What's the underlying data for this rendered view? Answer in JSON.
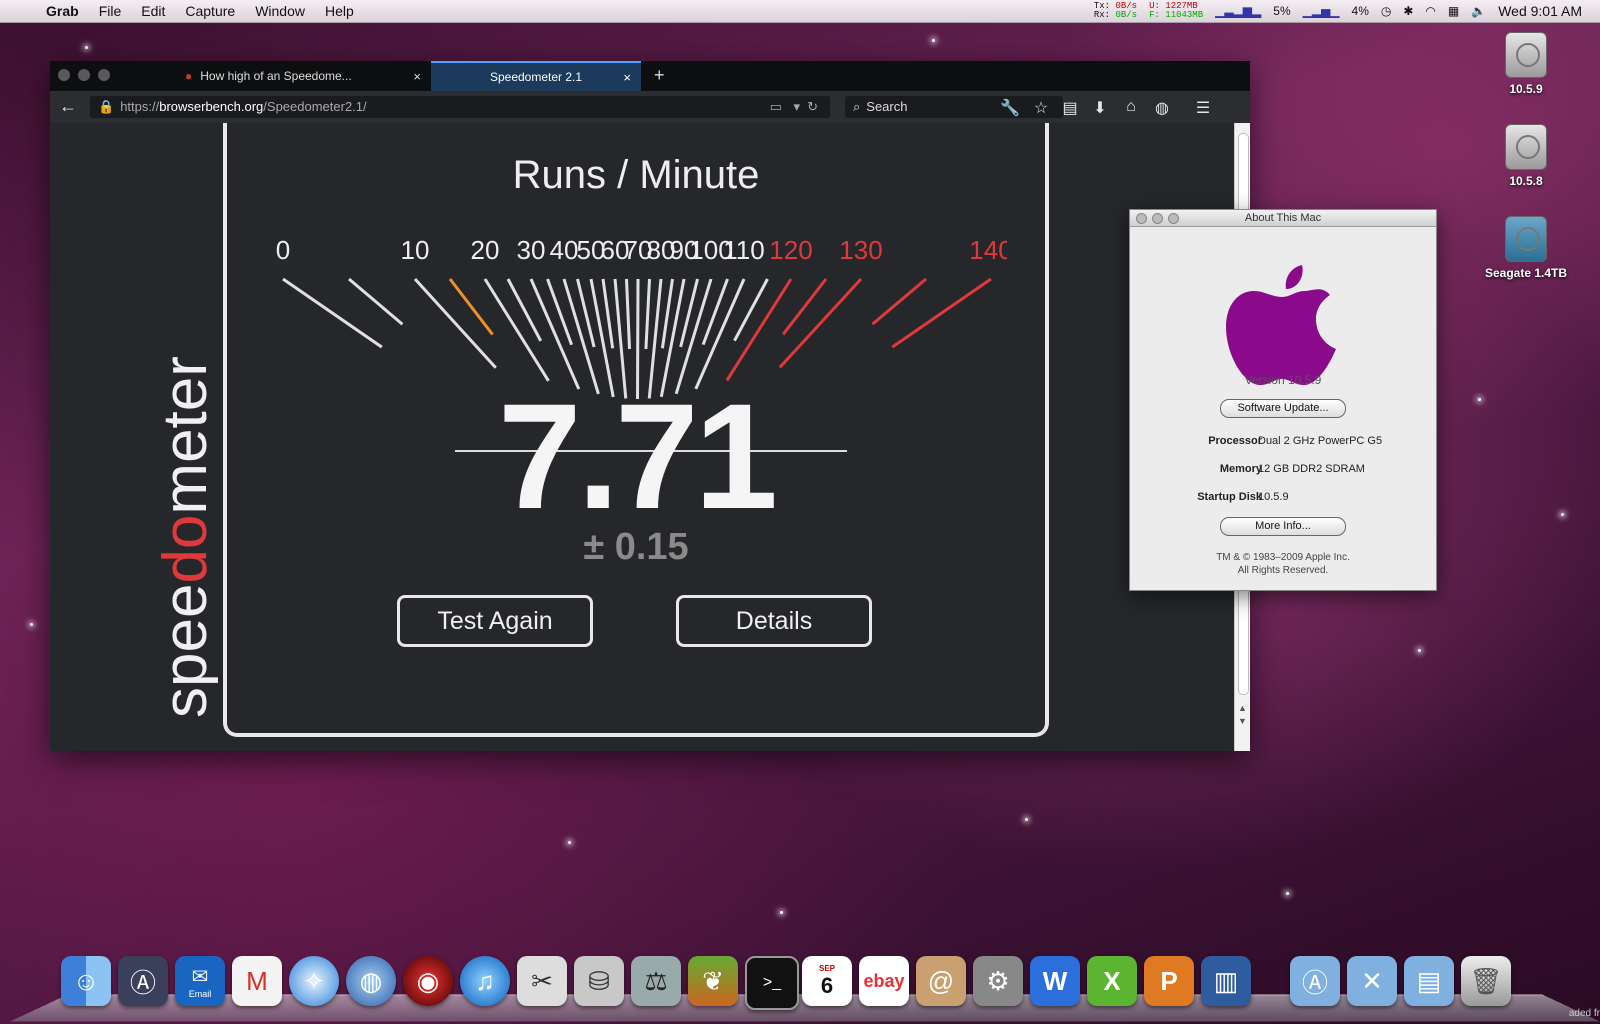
{
  "menubar": {
    "apple_glyph": "",
    "app_name": "Grab",
    "menus": [
      "File",
      "Edit",
      "Capture",
      "Window",
      "Help"
    ],
    "net_tx_label": "Tx:",
    "net_rx_label": "Rx:",
    "net_tx": "0B/s",
    "net_rx": "0B/s",
    "mem_u": "U: 1227MB",
    "mem_f": "F: 11043MB",
    "cpu1": "5%",
    "cpu2": "4%",
    "clock": "Wed 9:01 AM"
  },
  "browser": {
    "tabs": [
      {
        "label": "How high of an Speedome...",
        "close": "×"
      },
      {
        "label": "Speedometer 2.1",
        "close": "×"
      }
    ],
    "new_tab": "+",
    "url_prefix": "https://",
    "url_domain": "browserbench.org",
    "url_path": "/Speedometer2.1/",
    "search_placeholder": "Search"
  },
  "speedometer": {
    "logo_text": "speedometer",
    "title": "Runs / Minute",
    "gauge_labels": [
      "0",
      "10",
      "20",
      "30",
      "40",
      "50",
      "60",
      "70",
      "80",
      "90",
      "100",
      "110",
      "120",
      "130",
      "140"
    ],
    "score": "7.71",
    "margin": "± 0.15",
    "score_value": 7.71,
    "test_again": "Test Again",
    "details": "Details"
  },
  "about": {
    "title": "About This Mac",
    "version": "Version 10.5.9",
    "software_update": "Software Update...",
    "specs": [
      {
        "key": "Processor",
        "value": "Dual 2 GHz PowerPC G5"
      },
      {
        "key": "Memory",
        "value": "12 GB DDR2 SDRAM"
      },
      {
        "key": "Startup Disk",
        "value": "10.5.9"
      }
    ],
    "more_info": "More Info...",
    "copyright_1": "TM & © 1983–2009 Apple Inc.",
    "copyright_2": "All Rights Reserved."
  },
  "desktop": {
    "icons": [
      "10.5.9",
      "10.5.8",
      "Seagate 1.4TB"
    ]
  },
  "dock": {
    "email_label": "Email",
    "calendar_day": "6",
    "calendar_month": "SEP",
    "ebay_label": "ebay",
    "edge_text": "aded fr"
  },
  "colors": {
    "gauge_white": "#e0e0e0",
    "gauge_orange": "#f0902a",
    "gauge_red": "#e0393b",
    "tab_active": "#1b3a5c",
    "apple_logo": "#8b0a8b"
  }
}
